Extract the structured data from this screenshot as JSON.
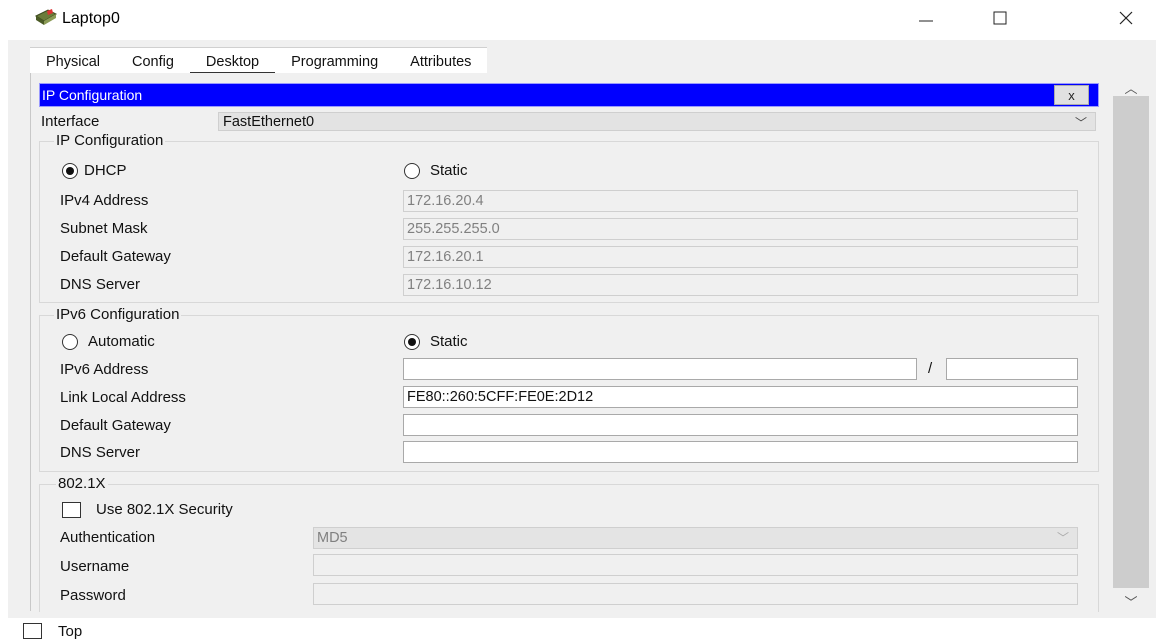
{
  "window": {
    "title": "Laptop0",
    "icon": "laptop-icon",
    "controls": {
      "minimize": "—",
      "maximize": "☐",
      "close": "✕"
    }
  },
  "tabs": [
    {
      "label": "Physical"
    },
    {
      "label": "Config"
    },
    {
      "label": "Desktop"
    },
    {
      "label": "Programming"
    },
    {
      "label": "Attributes"
    }
  ],
  "active_tab": "Desktop",
  "ip_config": {
    "bar_title": "IP Configuration",
    "close_label": "x",
    "interface_label": "Interface",
    "interface_value": "FastEthernet0",
    "ipv4": {
      "group_title": "IP Configuration",
      "dhcp_label": "DHCP",
      "static_label": "Static",
      "mode": "DHCP",
      "ipv4_address_label": "IPv4 Address",
      "ipv4_address": "172.16.20.4",
      "subnet_mask_label": "Subnet Mask",
      "subnet_mask": "255.255.255.0",
      "gateway_label": "Default Gateway",
      "gateway": "172.16.20.1",
      "dns_label": "DNS Server",
      "dns": "172.16.10.12"
    },
    "ipv6": {
      "group_title": "IPv6 Configuration",
      "automatic_label": "Automatic",
      "static_label": "Static",
      "mode": "Static",
      "ipv6_address_label": "IPv6 Address",
      "ipv6_address": "",
      "prefix_separator": "/",
      "prefix_length": "",
      "link_local_label": "Link Local Address",
      "link_local": "FE80::260:5CFF:FE0E:2D12",
      "gateway_label": "Default Gateway",
      "gateway": "",
      "dns_label": "DNS Server",
      "dns": ""
    },
    "dot1x": {
      "group_title": "802.1X",
      "use_security_label": "Use 802.1X Security",
      "use_security_checked": false,
      "auth_label": "Authentication",
      "auth_value": "MD5",
      "username_label": "Username",
      "username": "",
      "password_label": "Password",
      "password": ""
    }
  },
  "footer": {
    "top_label": "Top",
    "top_checked": false
  },
  "colors": {
    "ip_bar": "#0000ff",
    "panel_bg": "#f0f0f0"
  }
}
